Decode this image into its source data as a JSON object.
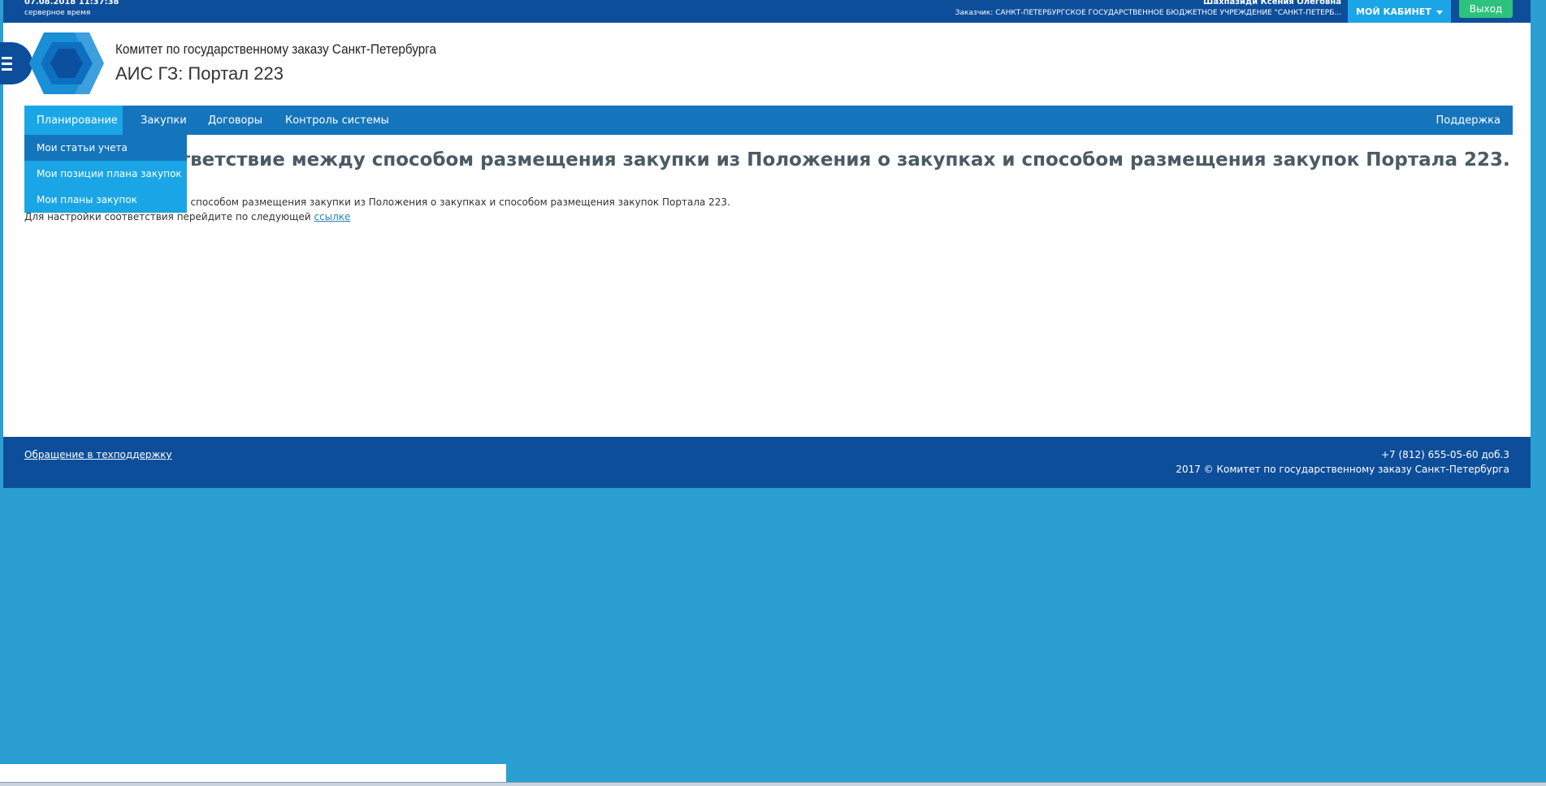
{
  "topbar": {
    "datetime": "07.08.2018 11:37:38",
    "time_label": "серверное время",
    "user_name": "Шахпазиди Ксения Олеговна",
    "customer": "Заказчик: САНКТ-ПЕТЕРБУРГСКОЕ ГОСУДАРСТВЕННОЕ БЮДЖЕТНОЕ УЧРЕЖДЕНИЕ \"САНКТ-ПЕТЕРБ...",
    "cabinet_label": "МОЙ КАБИНЕТ",
    "exit_label": "Выход"
  },
  "header": {
    "org_name": "Комитет по государственному заказу Санкт-Петербурга",
    "portal_name": "АИС ГЗ: Портал 223"
  },
  "nav": {
    "items": [
      {
        "label": "Планирование"
      },
      {
        "label": "Закупки"
      },
      {
        "label": "Договоры"
      },
      {
        "label": "Контроль системы"
      }
    ],
    "support": "Поддержка",
    "dropdown": [
      {
        "label": "Мои статьи учета"
      },
      {
        "label": "Мои позиции плана закупок"
      },
      {
        "label": "Мои планы закупок"
      }
    ]
  },
  "content": {
    "title": "Не задано соответствие между способом размещения закупки из Положения о закупках и способом размещения закупок Портала 223.",
    "line1": "Не задано соответствие между способом размещения закупки из Положения о закупках и способом размещения закупок Портала 223.",
    "line2_text": "Для настройки соответствия перейдите по следующей ",
    "line2_link": "ссылке"
  },
  "footer": {
    "support_link": "Обращение в техподдержку",
    "phone": "+7 (812) 655-05-60 доб.3",
    "copyright": "2017 © Комитет по государственному заказу Санкт-Петербурга"
  },
  "colors": {
    "dark_blue": "#0d4e9b",
    "nav_blue": "#1475bd",
    "accent": "#1aa6e6",
    "exit_green": "#2ec27e",
    "page_bg": "#2b9fd1"
  }
}
